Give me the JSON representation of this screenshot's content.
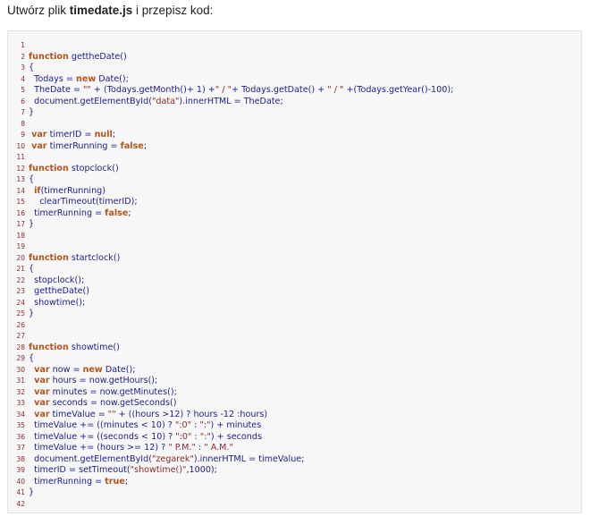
{
  "instruction": {
    "prefix": "Utwórz plik ",
    "filename": "timedate.js",
    "suffix": " i przepisz kod:"
  },
  "code": {
    "lines": [
      {
        "n": "1",
        "tokens": []
      },
      {
        "n": "2",
        "tokens": [
          {
            "t": "kw",
            "v": "function"
          },
          {
            "t": "txt",
            "v": " gettheDate()"
          }
        ]
      },
      {
        "n": "3",
        "tokens": [
          {
            "t": "txt",
            "v": "{"
          }
        ]
      },
      {
        "n": "4",
        "tokens": [
          {
            "t": "txt",
            "v": "  Todays = "
          },
          {
            "t": "kw",
            "v": "new"
          },
          {
            "t": "txt",
            "v": " Date();"
          }
        ]
      },
      {
        "n": "5",
        "tokens": [
          {
            "t": "txt",
            "v": "  TheDate = "
          },
          {
            "t": "str",
            "v": "\"\""
          },
          {
            "t": "txt",
            "v": " + (Todays.getMonth()+ 1) +"
          },
          {
            "t": "str",
            "v": "\" / \""
          },
          {
            "t": "txt",
            "v": "+ Todays.getDate() + "
          },
          {
            "t": "str",
            "v": "\" / \""
          },
          {
            "t": "txt",
            "v": " +(Todays.getYear()-100);"
          }
        ]
      },
      {
        "n": "6",
        "tokens": [
          {
            "t": "txt",
            "v": "  document.getElementById("
          },
          {
            "t": "str",
            "v": "\"data\""
          },
          {
            "t": "txt",
            "v": ").innerHTML = TheDate;"
          }
        ]
      },
      {
        "n": "7",
        "tokens": [
          {
            "t": "txt",
            "v": "}"
          }
        ]
      },
      {
        "n": "8",
        "tokens": []
      },
      {
        "n": "9",
        "tokens": [
          {
            "t": "txt",
            "v": " "
          },
          {
            "t": "kw",
            "v": "var"
          },
          {
            "t": "txt",
            "v": " timerID = "
          },
          {
            "t": "kw",
            "v": "null"
          },
          {
            "t": "txt",
            "v": ";"
          }
        ]
      },
      {
        "n": "10",
        "tokens": [
          {
            "t": "txt",
            "v": " "
          },
          {
            "t": "kw",
            "v": "var"
          },
          {
            "t": "txt",
            "v": " timerRunning = "
          },
          {
            "t": "kw",
            "v": "false"
          },
          {
            "t": "txt",
            "v": ";"
          }
        ]
      },
      {
        "n": "11",
        "tokens": []
      },
      {
        "n": "12",
        "tokens": [
          {
            "t": "kw",
            "v": "function"
          },
          {
            "t": "txt",
            "v": " stopclock()"
          }
        ]
      },
      {
        "n": "13",
        "tokens": [
          {
            "t": "txt",
            "v": "{"
          }
        ]
      },
      {
        "n": "14",
        "tokens": [
          {
            "t": "txt",
            "v": "  "
          },
          {
            "t": "kw",
            "v": "if"
          },
          {
            "t": "txt",
            "v": "(timerRunning)"
          }
        ]
      },
      {
        "n": "15",
        "tokens": [
          {
            "t": "txt",
            "v": "    clearTimeout(timerID);"
          }
        ]
      },
      {
        "n": "16",
        "tokens": [
          {
            "t": "txt",
            "v": "  timerRunning = "
          },
          {
            "t": "kw",
            "v": "false"
          },
          {
            "t": "txt",
            "v": ";"
          }
        ]
      },
      {
        "n": "17",
        "tokens": [
          {
            "t": "txt",
            "v": "}"
          }
        ]
      },
      {
        "n": "18",
        "tokens": []
      },
      {
        "n": "19",
        "tokens": []
      },
      {
        "n": "20",
        "tokens": [
          {
            "t": "kw",
            "v": "function"
          },
          {
            "t": "txt",
            "v": " startclock()"
          }
        ]
      },
      {
        "n": "21",
        "tokens": [
          {
            "t": "txt",
            "v": "{"
          }
        ]
      },
      {
        "n": "22",
        "tokens": [
          {
            "t": "txt",
            "v": "  stopclock();"
          }
        ]
      },
      {
        "n": "23",
        "tokens": [
          {
            "t": "txt",
            "v": "  gettheDate()"
          }
        ]
      },
      {
        "n": "24",
        "tokens": [
          {
            "t": "txt",
            "v": "  showtime();"
          }
        ]
      },
      {
        "n": "25",
        "tokens": [
          {
            "t": "txt",
            "v": "}"
          }
        ]
      },
      {
        "n": "26",
        "tokens": []
      },
      {
        "n": "27",
        "tokens": []
      },
      {
        "n": "28",
        "tokens": [
          {
            "t": "kw",
            "v": "function"
          },
          {
            "t": "txt",
            "v": " showtime()"
          }
        ]
      },
      {
        "n": "29",
        "tokens": [
          {
            "t": "txt",
            "v": "{"
          }
        ]
      },
      {
        "n": "30",
        "tokens": [
          {
            "t": "txt",
            "v": "  "
          },
          {
            "t": "kw",
            "v": "var"
          },
          {
            "t": "txt",
            "v": " now = "
          },
          {
            "t": "kw",
            "v": "new"
          },
          {
            "t": "txt",
            "v": " Date();"
          }
        ]
      },
      {
        "n": "31",
        "tokens": [
          {
            "t": "txt",
            "v": "  "
          },
          {
            "t": "kw",
            "v": "var"
          },
          {
            "t": "txt",
            "v": " hours = now.getHours();"
          }
        ]
      },
      {
        "n": "32",
        "tokens": [
          {
            "t": "txt",
            "v": "  "
          },
          {
            "t": "kw",
            "v": "var"
          },
          {
            "t": "txt",
            "v": " minutes = now.getMinutes();"
          }
        ]
      },
      {
        "n": "33",
        "tokens": [
          {
            "t": "txt",
            "v": "  "
          },
          {
            "t": "kw",
            "v": "var"
          },
          {
            "t": "txt",
            "v": " seconds = now.getSeconds()"
          }
        ]
      },
      {
        "n": "34",
        "tokens": [
          {
            "t": "txt",
            "v": "  "
          },
          {
            "t": "kw",
            "v": "var"
          },
          {
            "t": "txt",
            "v": " timeValue = "
          },
          {
            "t": "str",
            "v": "\"\""
          },
          {
            "t": "txt",
            "v": " + ((hours >12) ? hours -12 :hours)"
          }
        ]
      },
      {
        "n": "35",
        "tokens": [
          {
            "t": "txt",
            "v": "  timeValue += ((minutes < 10) ? "
          },
          {
            "t": "str",
            "v": "\":0\""
          },
          {
            "t": "txt",
            "v": " : "
          },
          {
            "t": "str",
            "v": "\":\""
          },
          {
            "t": "txt",
            "v": ") + minutes"
          }
        ]
      },
      {
        "n": "36",
        "tokens": [
          {
            "t": "txt",
            "v": "  timeValue += ((seconds < 10) ? "
          },
          {
            "t": "str",
            "v": "\":0\""
          },
          {
            "t": "txt",
            "v": " : "
          },
          {
            "t": "str",
            "v": "\":\""
          },
          {
            "t": "txt",
            "v": ") + seconds"
          }
        ]
      },
      {
        "n": "37",
        "tokens": [
          {
            "t": "txt",
            "v": "  timeValue += (hours >= 12) ? "
          },
          {
            "t": "str",
            "v": "\" P.M.\""
          },
          {
            "t": "txt",
            "v": " : "
          },
          {
            "t": "str",
            "v": "\" A.M.\""
          }
        ]
      },
      {
        "n": "38",
        "tokens": [
          {
            "t": "txt",
            "v": "  document.getElementById("
          },
          {
            "t": "str",
            "v": "\"zegarek\""
          },
          {
            "t": "txt",
            "v": ").innerHTML = timeValue;"
          }
        ]
      },
      {
        "n": "39",
        "tokens": [
          {
            "t": "txt",
            "v": "  timerID = setTimeout("
          },
          {
            "t": "str",
            "v": "\"showtime()\""
          },
          {
            "t": "txt",
            "v": ",1000);"
          }
        ]
      },
      {
        "n": "40",
        "tokens": [
          {
            "t": "txt",
            "v": "  timerRunning = "
          },
          {
            "t": "kw",
            "v": "true"
          },
          {
            "t": "txt",
            "v": ";"
          }
        ]
      },
      {
        "n": "41",
        "tokens": [
          {
            "t": "txt",
            "v": "}"
          }
        ]
      },
      {
        "n": "42",
        "tokens": []
      }
    ]
  }
}
